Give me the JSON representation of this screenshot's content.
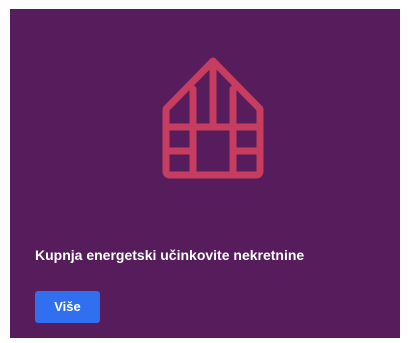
{
  "card": {
    "title": "Kupnja energetski učinkovite nekretnine",
    "button_label": "Više",
    "icon": "greenhouse-house-icon",
    "colors": {
      "background": "#561c5c",
      "icon": "#c63d5f",
      "button": "#2f6ff0",
      "text": "#ffffff"
    }
  }
}
